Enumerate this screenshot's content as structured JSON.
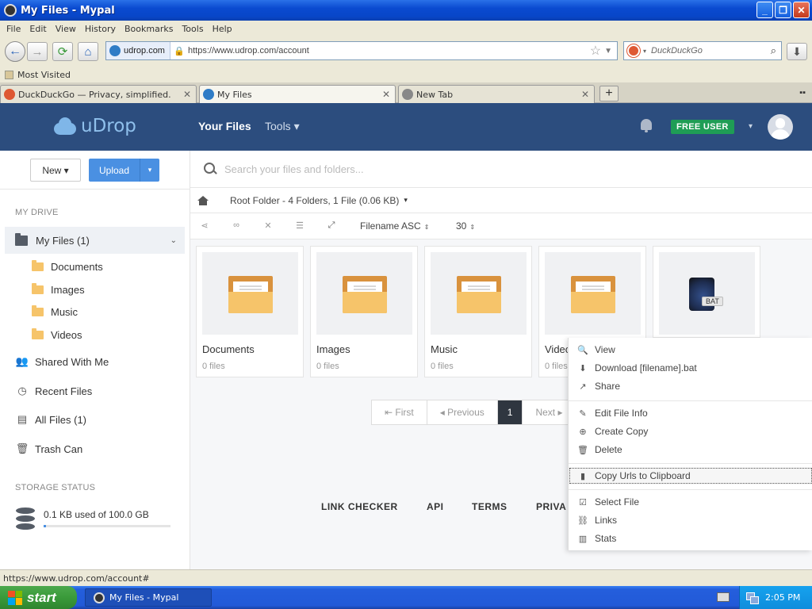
{
  "window": {
    "title": "My Files - Mypal",
    "minimize_glyph": "_",
    "maximize_glyph": "❐",
    "close_glyph": "✕"
  },
  "menubar": [
    "File",
    "Edit",
    "View",
    "History",
    "Bookmarks",
    "Tools",
    "Help"
  ],
  "navbar": {
    "back_glyph": "←",
    "forward_glyph": "→",
    "reload_glyph": "⟳",
    "home_glyph": "⌂",
    "site_identity": "udrop.com",
    "url": "https://www.udrop.com/account",
    "search_engine_placeholder": "DuckDuckGo",
    "search_glyph": "⌕",
    "download_glyph": "⬇"
  },
  "bookmarks": {
    "most_visited": "Most Visited"
  },
  "tabs": [
    {
      "label": "DuckDuckGo — Privacy, simplified.",
      "icon_color": "#de5833",
      "active": false
    },
    {
      "label": "My Files",
      "icon_color": "#2f7cc6",
      "active": true
    },
    {
      "label": "New Tab",
      "icon_color": "#888888",
      "active": false
    }
  ],
  "tab_controls": {
    "new_tab_glyph": "+",
    "tab_list_glyph": "▪▪"
  },
  "header": {
    "brand": "uDrop",
    "nav_your_files": "Your Files",
    "nav_tools": "Tools ▾",
    "user_badge": "FREE USER",
    "user_caret": "▾"
  },
  "sidebar": {
    "new_button": "New ▾",
    "upload_button": "Upload",
    "upload_caret": "▾",
    "my_drive_heading": "MY DRIVE",
    "my_files": "My Files (1)",
    "my_files_chevron": "⌄",
    "folders": [
      "Documents",
      "Images",
      "Music",
      "Videos"
    ],
    "items": [
      {
        "label": "Shared With Me",
        "icon": "👥"
      },
      {
        "label": "Recent Files",
        "icon": "◷"
      },
      {
        "label": "All Files (1)",
        "icon": "▤"
      },
      {
        "label": "Trash Can",
        "icon": "🗑"
      }
    ],
    "storage_heading": "STORAGE STATUS",
    "storage_text": "0.1 KB used of 100.0 GB",
    "storage_used_fraction": 0.02
  },
  "main": {
    "search_placeholder": "Search your files and folders...",
    "breadcrumb": "Root Folder - 4 Folders, 1 File (0.06 KB)",
    "breadcrumb_caret": "▾",
    "toolbar": {
      "share_glyph": "⋖",
      "link_glyph": "∞",
      "remove_glyph": "✕",
      "list_glyph": "☰",
      "expand_glyph": "⤢",
      "sort": "Filename ASC",
      "per_page": "30",
      "updown_glyph": "⇕"
    },
    "cards": [
      {
        "name": "Documents",
        "meta": "0 files",
        "type": "folder"
      },
      {
        "name": "Images",
        "meta": "0 files",
        "type": "folder"
      },
      {
        "name": "Music",
        "meta": "0 files",
        "type": "folder"
      },
      {
        "name": "Videos",
        "meta": "0 files",
        "type": "folder"
      },
      {
        "name": "",
        "meta": "",
        "type": "bat",
        "icon_label": "BAT"
      }
    ],
    "pager": {
      "first": "⇤ First",
      "previous": "◂ Previous",
      "current": "1",
      "next": "Next ▸"
    },
    "footer_links": [
      "LINK CHECKER",
      "API",
      "TERMS",
      "PRIVA"
    ]
  },
  "context_menu": [
    {
      "label": "View",
      "icon": "🔍"
    },
    {
      "label": "Download [filename].bat",
      "icon": "⬇"
    },
    {
      "label": "Share",
      "icon": "↗"
    },
    {
      "label": "Edit File Info",
      "icon": "✎"
    },
    {
      "label": "Create Copy",
      "icon": "⊕"
    },
    {
      "label": "Delete",
      "icon": "🗑"
    },
    {
      "label": "Copy Urls to Clipboard",
      "icon": "▮"
    },
    {
      "label": "Select File",
      "icon": "☑"
    },
    {
      "label": "Links",
      "icon": "⛓"
    },
    {
      "label": "Stats",
      "icon": "▥"
    }
  ],
  "statusbar": {
    "text": "https://www.udrop.com/account#"
  },
  "taskbar": {
    "start": "start",
    "task_label": "My Files - Mypal",
    "clock": "2:05 PM"
  },
  "colors": {
    "header_bg": "#2c4d7e",
    "accent": "#4a90e2",
    "badge_green": "#1f9d55",
    "folder_yellow": "#f6c46a"
  }
}
